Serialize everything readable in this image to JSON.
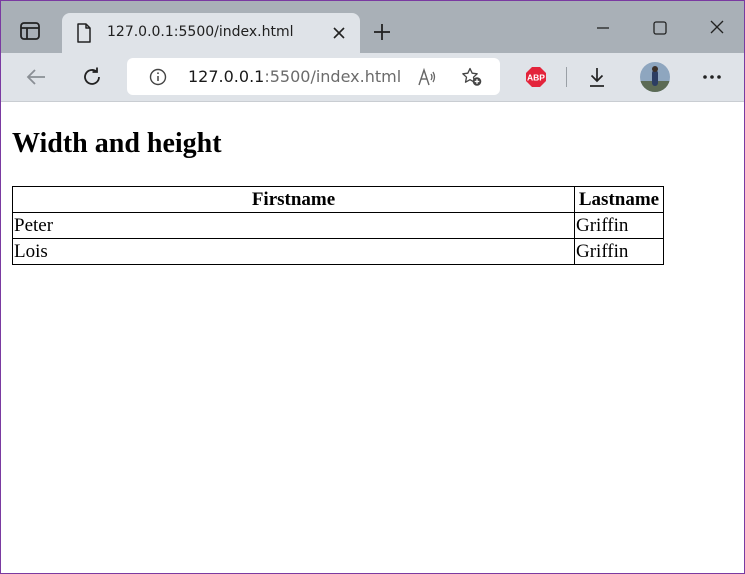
{
  "browser": {
    "tab": {
      "title": "127.0.0.1:5500/index.html",
      "icon": "file-icon"
    },
    "address_bar": {
      "host": "127.0.0.1",
      "rest": ":5500/index.html"
    },
    "extensions": {
      "adblock_label": "ABP"
    },
    "colors": {
      "tabstrip": "#a9b0b7",
      "toolbar": "#dfe3e8",
      "abp_red": "#e3243b"
    }
  },
  "page": {
    "heading": "Width and height",
    "table": {
      "headers": [
        "Firstname",
        "Lastname"
      ],
      "rows": [
        [
          "Peter",
          "Griffin"
        ],
        [
          "Lois",
          "Griffin"
        ]
      ]
    }
  }
}
